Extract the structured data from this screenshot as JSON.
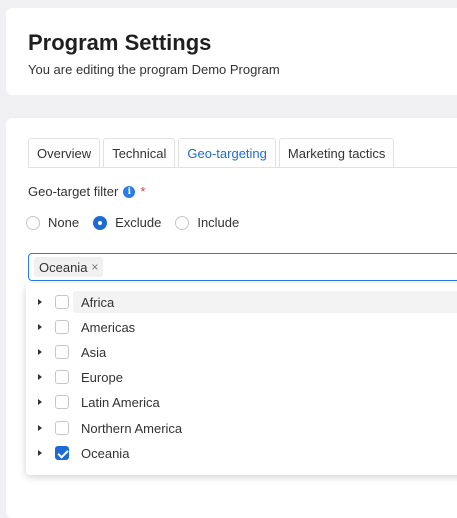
{
  "header": {
    "title": "Program Settings",
    "subtitle": "You are editing the program Demo Program"
  },
  "tabs": [
    {
      "label": "Overview",
      "active": false
    },
    {
      "label": "Technical",
      "active": false
    },
    {
      "label": "Geo-targeting",
      "active": true
    },
    {
      "label": "Marketing tactics",
      "active": false
    }
  ],
  "geo_filter": {
    "label": "Geo-target filter",
    "required_mark": "*",
    "info_icon": "i",
    "options": [
      {
        "label": "None",
        "selected": false
      },
      {
        "label": "Exclude",
        "selected": true
      },
      {
        "label": "Include",
        "selected": false
      }
    ],
    "selected_tags": [
      {
        "label": "Oceania",
        "close": "×"
      }
    ]
  },
  "dropdown": {
    "items": [
      {
        "label": "Africa",
        "checked": false
      },
      {
        "label": "Americas",
        "checked": false
      },
      {
        "label": "Asia",
        "checked": false
      },
      {
        "label": "Europe",
        "checked": false
      },
      {
        "label": "Latin America",
        "checked": false
      },
      {
        "label": "Northern America",
        "checked": false
      },
      {
        "label": "Oceania",
        "checked": true
      }
    ]
  },
  "colors": {
    "accent": "#1e6ad6",
    "info": "#2a7be4",
    "required": "#d94040"
  }
}
